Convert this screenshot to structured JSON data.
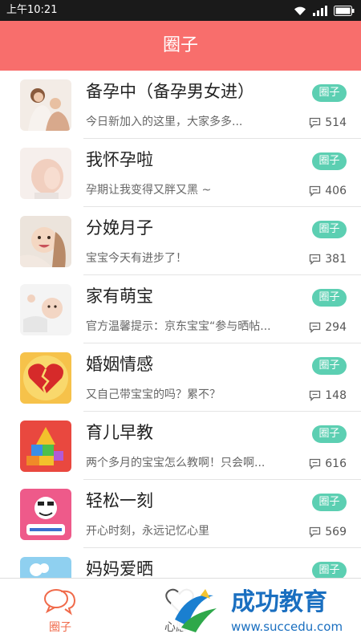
{
  "status_bar": {
    "time": "上午10:21",
    "icons": [
      "wifi-icon",
      "signal-icon",
      "battery-icon"
    ]
  },
  "header": {
    "title": "圈子"
  },
  "tag_label": "圈子",
  "groups": [
    {
      "name": "备孕中（备孕男女进）",
      "latest": "今日新加入的这里，大家多多...",
      "count": "514",
      "thumb": "couple-photo"
    },
    {
      "name": "我怀孕啦",
      "latest": "孕期让我变得又胖又黑 ~",
      "count": "406",
      "thumb": "pregnant-belly-photo"
    },
    {
      "name": "分娩月子",
      "latest": "宝宝今天有进步了！",
      "count": "381",
      "thumb": "mother-baby-photo"
    },
    {
      "name": "家有萌宝",
      "latest": "官方温馨提示：京东宝宝“参与晒帖...",
      "count": "294",
      "thumb": "baby-photo"
    },
    {
      "name": "婚姻情感",
      "latest": "又自己带宝宝的吗？累不？",
      "count": "148",
      "thumb": "broken-heart-icon"
    },
    {
      "name": "育儿早教",
      "latest": "两个多月的宝宝怎么教啊！只会啊...",
      "count": "616",
      "thumb": "building-blocks-icon"
    },
    {
      "name": "轻松一刻",
      "latest": "开心时刻，永远记忆心里",
      "count": "569",
      "thumb": "meme-face-icon"
    },
    {
      "name": "妈妈爱晒",
      "latest": "",
      "count": "",
      "thumb": "landscape-photo"
    }
  ],
  "bottom_nav": {
    "items": [
      {
        "label": "圈子",
        "icon": "chat-bubbles-icon",
        "active": true
      },
      {
        "label": "心愿",
        "icon": "heart-icon",
        "active": false
      }
    ]
  },
  "watermark": {
    "title": "成功教育",
    "url": "www.succedu.com"
  },
  "colors": {
    "header": "#f86e6c",
    "tag": "#5ccfb2",
    "active_nav": "#f06a4a",
    "status_bar": "#1a1a1a"
  }
}
